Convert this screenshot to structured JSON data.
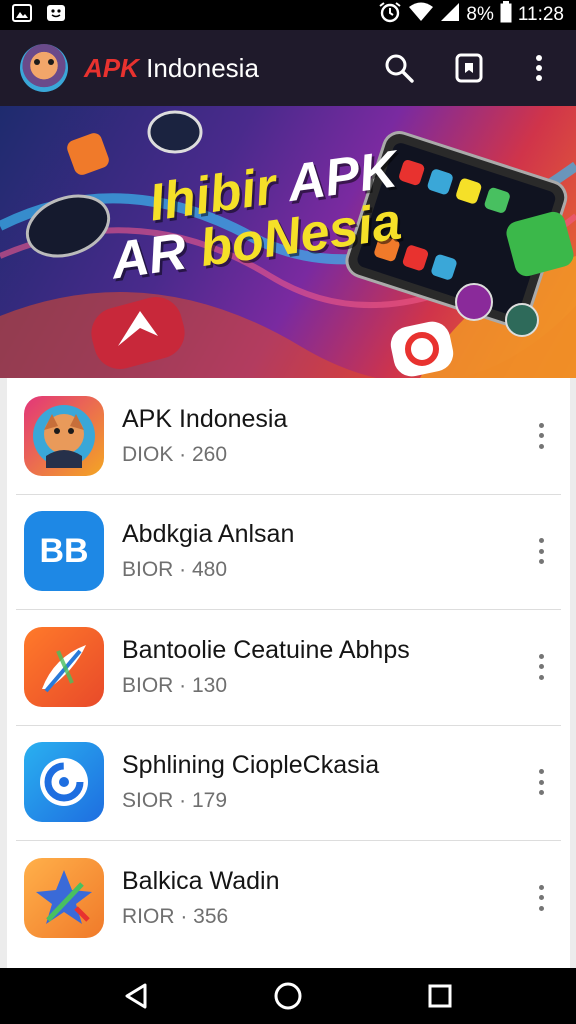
{
  "status_bar": {
    "time": "11:28",
    "battery": "8%",
    "icons": [
      "image-icon",
      "notification-icon",
      "alarm-icon",
      "wifi-icon",
      "signal-icon",
      "battery-icon"
    ]
  },
  "app_bar": {
    "brand": "APK",
    "title": "Indonesia",
    "actions": [
      "search-icon",
      "bookmark-icon",
      "overflow-menu-icon"
    ],
    "colors": {
      "background": "#1f1a2b",
      "brand": "#e8322f"
    }
  },
  "banner": {
    "line1_part1": "Ihibir",
    "line1_part2": "APK",
    "line2_part1": "AR",
    "line2_part2": "boNesia",
    "colors": {
      "yellow": "#f5e028",
      "white": "#ffffff"
    }
  },
  "apps": [
    {
      "name": "APK Indonesia",
      "meta": "DIOK · 260",
      "icon": "mascot-icon"
    },
    {
      "name": "Abdkgia Anlsan",
      "meta": "BIOR · 480",
      "icon": "bb-icon",
      "icon_text": "BB"
    },
    {
      "name": "Bantoolie Ceatuine Abhps",
      "meta": "BIOR · 130",
      "icon": "feather-icon"
    },
    {
      "name": "Sphlining CioplеCkasia",
      "meta": "SIOR · 179",
      "icon": "chat-swirl-icon"
    },
    {
      "name": "Balkica Wadin",
      "meta": "RIOR · 356",
      "icon": "star-arrow-icon"
    }
  ],
  "nav_bar": [
    "back-icon",
    "home-icon",
    "recents-icon"
  ]
}
